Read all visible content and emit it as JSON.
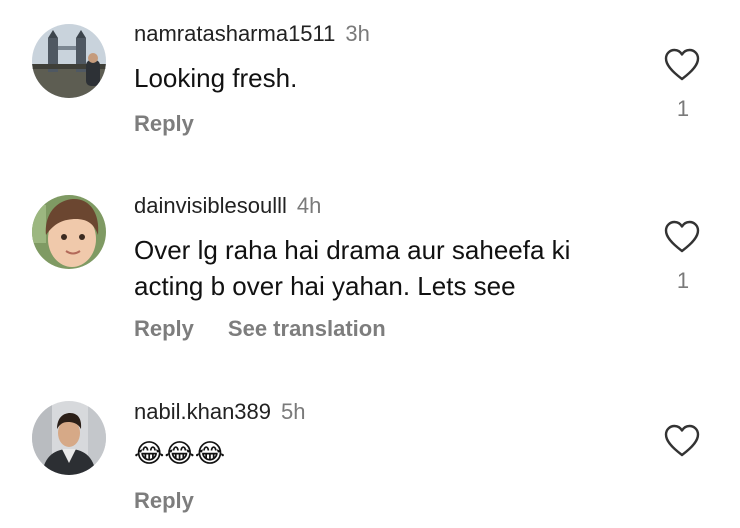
{
  "comments": [
    {
      "username": "namratasharma1511",
      "time": "3h",
      "text": "Looking fresh.",
      "actions": [
        "Reply"
      ],
      "likes": "1",
      "avatar_icon": "city-bridge-photo"
    },
    {
      "username": "dainvisiblesoulll",
      "time": "4h",
      "text": "Over lg raha hai drama aur saheefa ki acting b over hai yahan. Lets see",
      "actions": [
        "Reply",
        "See translation"
      ],
      "likes": "1",
      "avatar_icon": "child-photo"
    },
    {
      "username": "nabil.khan389",
      "time": "5h",
      "text": "😂😂😂",
      "actions": [
        "Reply"
      ],
      "likes": "",
      "avatar_icon": "man-photo"
    }
  ],
  "colors": {
    "muted": "#7a7a7a",
    "text": "#111111",
    "background": "#ffffff"
  }
}
